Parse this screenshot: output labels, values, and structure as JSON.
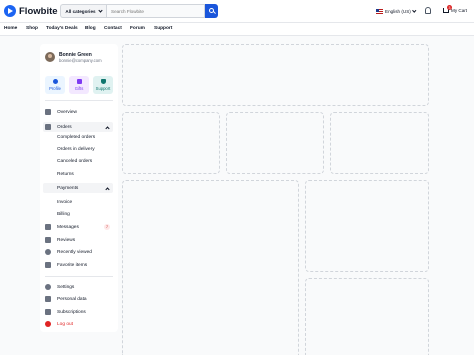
{
  "brand": {
    "name": "Flowbite"
  },
  "search": {
    "category_label": "All categories",
    "placeholder": "Search Flowbite"
  },
  "header": {
    "language": "English (US)",
    "cart_label": "My Cart",
    "cart_count": "3"
  },
  "nav": [
    "Home",
    "Shop",
    "Today's Deals",
    "Blog",
    "Contact",
    "Forum",
    "Support"
  ],
  "user": {
    "name": "Bonnie Green",
    "email": "bonnie@company.com"
  },
  "quick_actions": [
    {
      "label": "Profile",
      "icon": "user-icon",
      "color": "#1a56db",
      "bg": "#ebf5ff"
    },
    {
      "label": "Gifts",
      "icon": "gift-icon",
      "color": "#7e3af2",
      "bg": "#f3e8ff"
    },
    {
      "label": "Support",
      "icon": "shield-icon",
      "color": "#0f766e",
      "bg": "#e0f2f1"
    }
  ],
  "sidebar": {
    "overview": "Overview",
    "orders": "Orders",
    "orders_sub": [
      "Completed orders",
      "Orders in delivery",
      "Canceled orders",
      "Returns"
    ],
    "payments": "Payments",
    "payments_sub": [
      "Invoice",
      "Billing"
    ],
    "messages": "Messages",
    "messages_count": "7",
    "reviews": "Reviews",
    "recently_viewed": "Recently viewed",
    "favorites": "Favorite items",
    "settings": "Settings",
    "personal_data": "Personal data",
    "subscriptions": "Subscriptions",
    "logout": "Log out"
  },
  "colors": {
    "accent": "#1a56db",
    "danger": "#e02424"
  }
}
